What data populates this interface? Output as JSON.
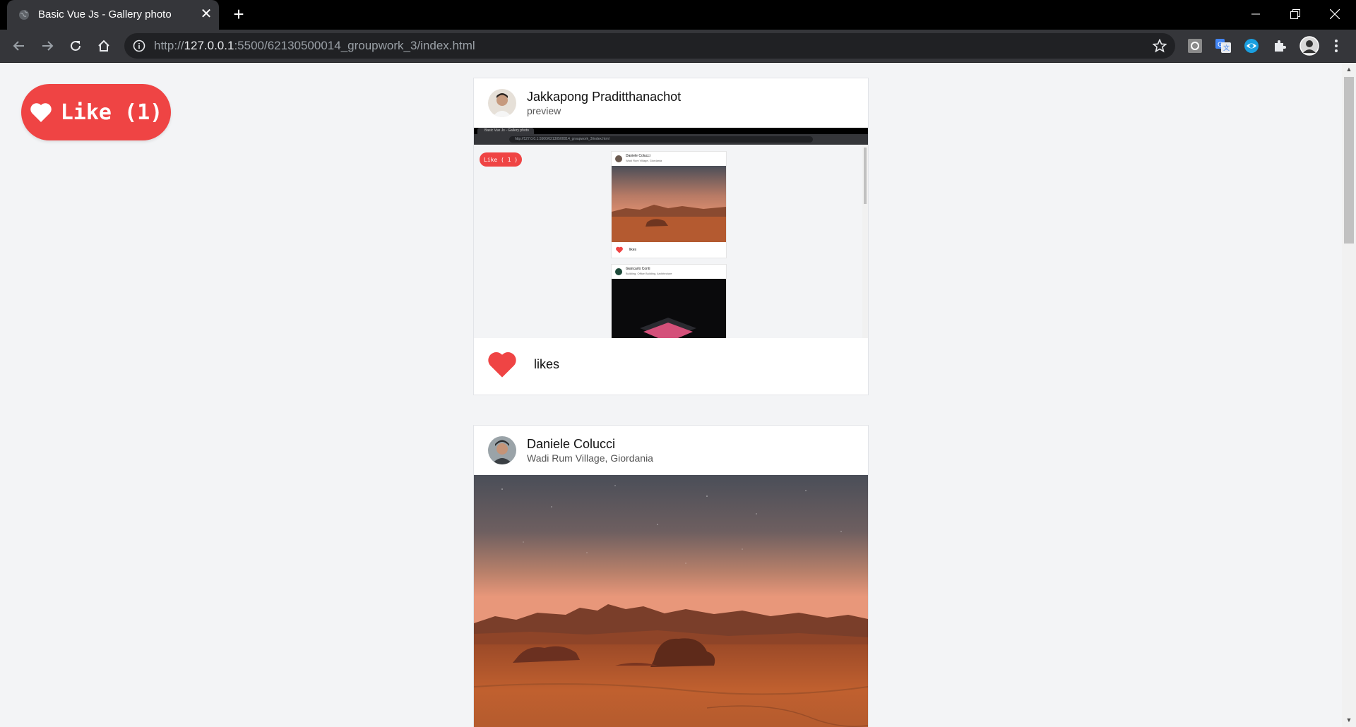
{
  "browser": {
    "tab_title": "Basic Vue Js - Gallery photo",
    "url_scheme": "http://",
    "url_host": "127.0.0.1",
    "url_rest": ":5500/62130500014_groupwork_3/index.html"
  },
  "like_button": {
    "label": "Like (1)"
  },
  "posts": [
    {
      "author": "Jakkapong Praditthanachot",
      "location": "preview",
      "likes_label": "likes",
      "preview": {
        "tab_title": "Basic Vue Js - Gallery photo",
        "url": "http://127.0.0.1:5500/62130500014_groupwork_3/index.html",
        "like_label": "Like ( 1 )",
        "cards": [
          {
            "author": "Daniele Colucci",
            "location": "Wadi Rum Village, Giordania",
            "likes_label": "likes"
          },
          {
            "author": "Giancarlo Conti",
            "location": "Building, Office Building, Architecture"
          }
        ]
      }
    },
    {
      "author": "Daniele Colucci",
      "location": "Wadi Rum Village, Giordania"
    }
  ],
  "colors": {
    "like_red": "#ef4444",
    "chrome_dark": "#35363a"
  }
}
